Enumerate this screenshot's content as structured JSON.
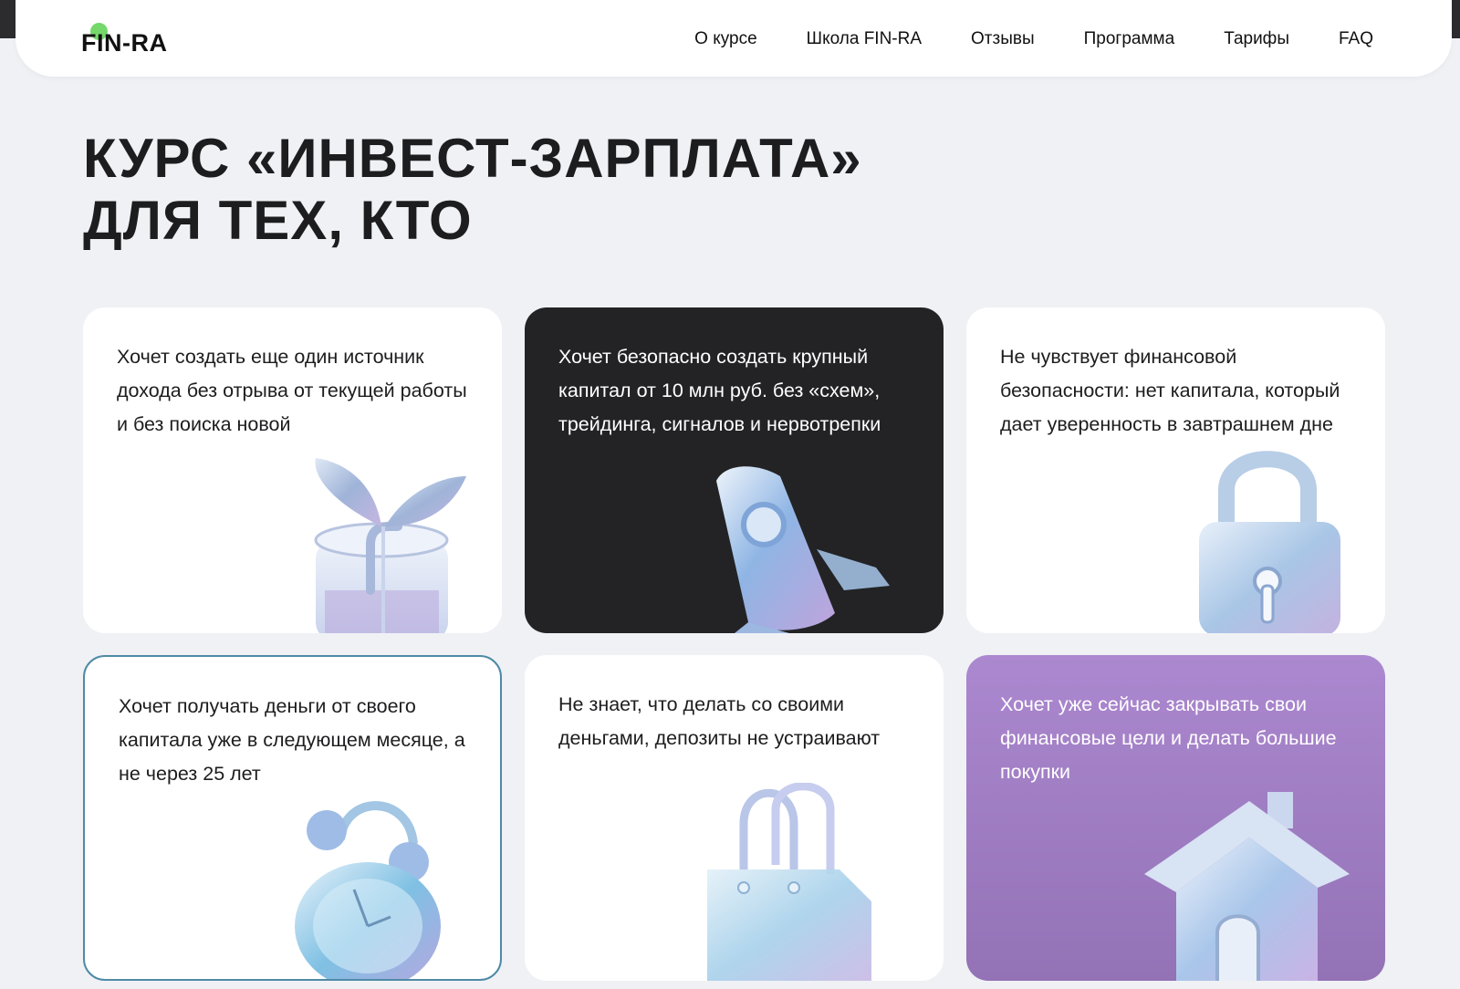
{
  "header": {
    "logo": "FIN-RA",
    "nav": [
      "О курсе",
      "Школа FIN-RA",
      "Отзывы",
      "Программа",
      "Тарифы",
      "FAQ"
    ]
  },
  "hero": {
    "line1": "КУРС «ИНВЕСТ-ЗАРПЛАТА»",
    "line2": "ДЛЯ ТЕХ, КТО"
  },
  "cards": [
    {
      "text": "Хочет создать еще один источник дохода без отрыва от текущей работы и без поиска новой",
      "icon": "plant-icon"
    },
    {
      "text": "Хочет безопасно создать крупный капитал от 10 млн руб. без «схем», трейдинга, сигналов и нервотрепки",
      "icon": "rocket-icon"
    },
    {
      "text": "Не чувствует финансовой безопасности: нет капитала, который дает уверенность в завтрашнем дне",
      "icon": "padlock-icon"
    },
    {
      "text": "Хочет получать деньги от своего капитала уже в следующем месяце, а не через 25 лет",
      "icon": "alarm-clock-icon"
    },
    {
      "text": "Не знает, что делать со своими деньгами, депозиты не устраивают",
      "icon": "shopping-bag-icon"
    },
    {
      "text": "Хочет уже сейчас закрывать свои финансовые цели и делать большие покупки",
      "icon": "house-icon"
    }
  ],
  "colors": {
    "background": "#eff1f5",
    "dark_card": "#232325",
    "purple_card": "#a583c9",
    "outline": "#4f8aa5",
    "logo_dot": "#74d86a"
  }
}
